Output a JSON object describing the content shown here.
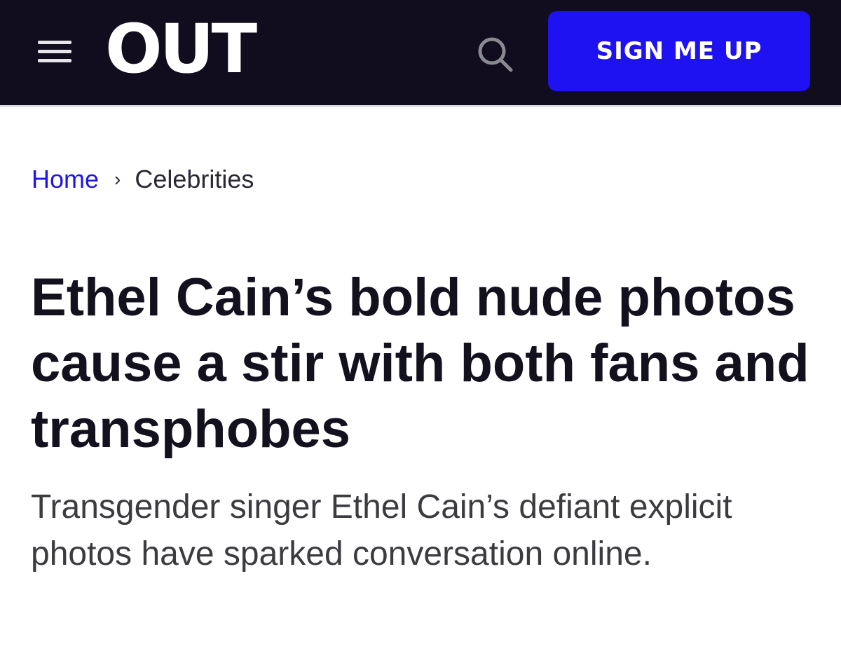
{
  "header": {
    "logo_text": "OUT",
    "signup_label": "SIGN ME UP",
    "menu_icon": "hamburger-menu-icon",
    "search_icon": "search-icon",
    "background_color": "#110d1f",
    "accent_color": "#1e12f2"
  },
  "breadcrumb": {
    "home_label": "Home",
    "separator": "›",
    "current_label": "Celebrities",
    "link_color": "#1f15e6"
  },
  "article": {
    "headline": "Ethel Cain’s bold nude photos cause a stir with both fans and transphobes",
    "subheadline": "Transgender singer Ethel Cain’s defiant explicit photos have sparked conversation online."
  }
}
